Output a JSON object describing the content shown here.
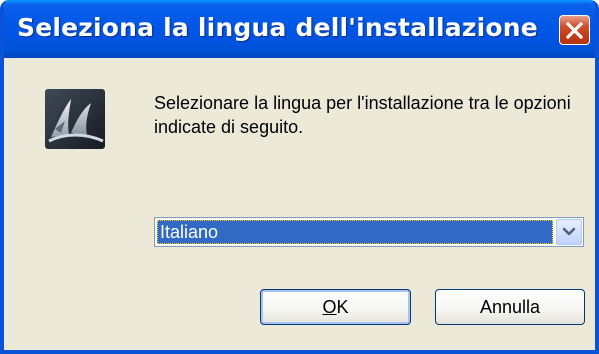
{
  "window": {
    "title": "Seleziona la lingua dell'installazione",
    "close_icon": "close-icon",
    "app_icon": "installer-logo-icon"
  },
  "message": "Selezionare la lingua per l'installazione tra le opzioni indicate di seguito.",
  "language_select": {
    "selected": "Italiano",
    "arrow_icon": "chevron-down-icon"
  },
  "buttons": {
    "ok_label": "OK",
    "cancel_label": "Annulla"
  },
  "colors": {
    "titlebar": "#0054e3",
    "dialog_bg": "#ece9d8",
    "selection": "#316ac5",
    "close_button": "#c23a16"
  }
}
